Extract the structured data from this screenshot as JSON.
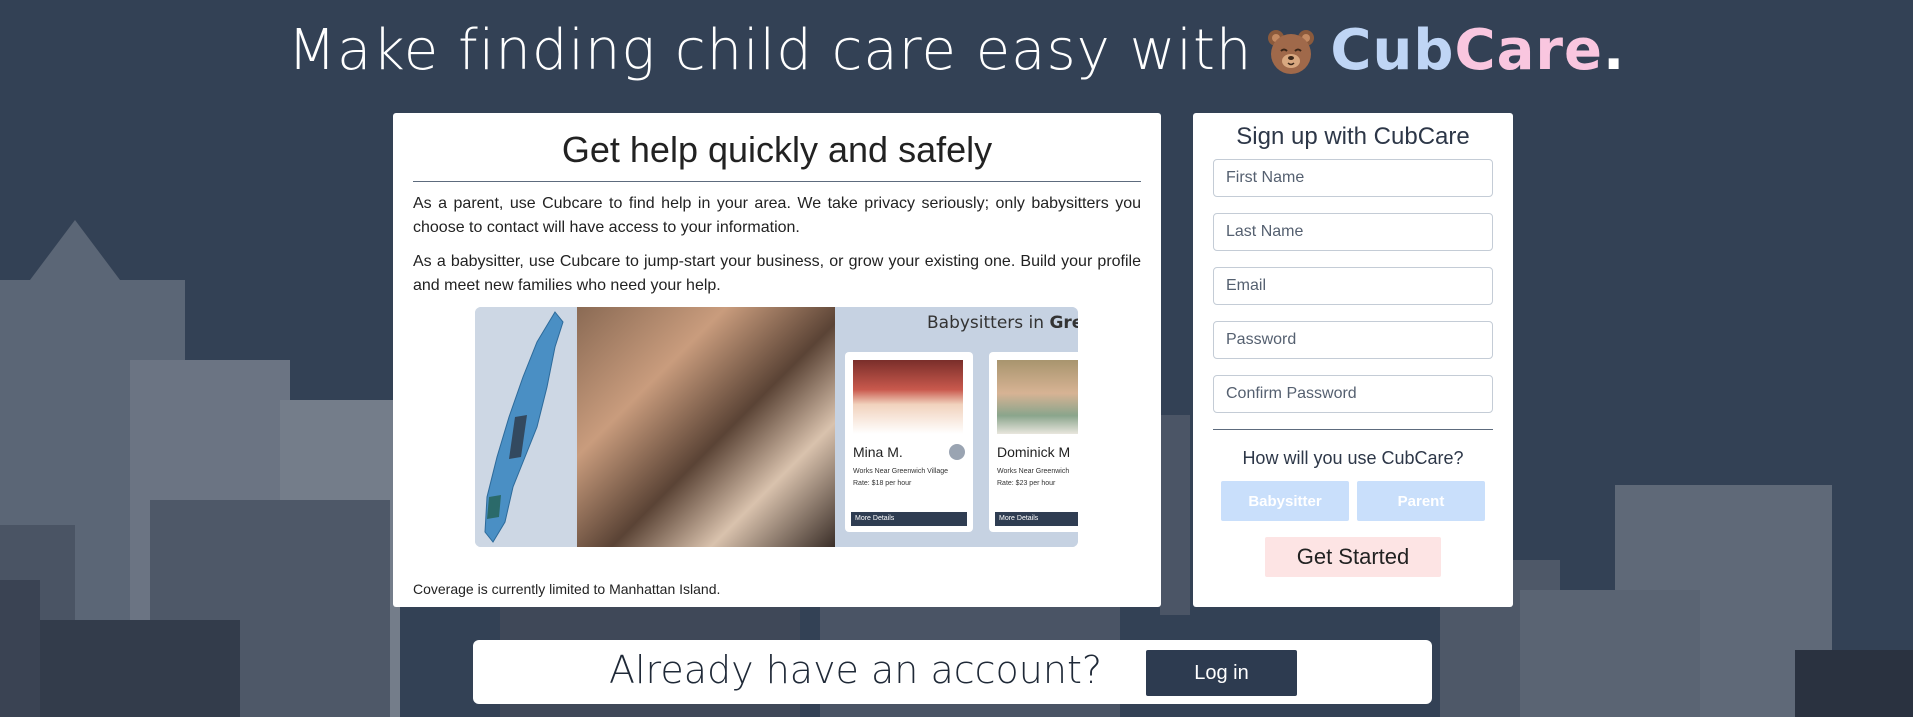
{
  "hero": {
    "headline": "Make finding child care easy with",
    "brand_part1": "Cub",
    "brand_part2": "Care",
    "brand_period": "."
  },
  "info": {
    "title": "Get help quickly and safely",
    "paragraph_parent": "As a parent, use Cubcare to find help in your area. We take privacy seriously; only babysitters you choose to contact will have access to your information.",
    "paragraph_sitter": "As a babysitter, use Cubcare to jump-start your business, or grow your existing one. Build your profile and meet new families who need your help.",
    "coverage": "Coverage is currently limited to Manhattan Island.",
    "promo": {
      "title_prefix": "Babysitters in ",
      "title_place": "Gree",
      "sitters": [
        {
          "name": "Mina M.",
          "location": "Works Near Greenwich Village",
          "rate": "Rate: $18 per hour",
          "more": "More Details"
        },
        {
          "name": "Dominick M",
          "location": "Works Near Greenwich",
          "rate": "Rate: $23 per hour",
          "more": "More Details"
        }
      ]
    }
  },
  "signup": {
    "title": "Sign up with CubCare",
    "fields": {
      "first_name": "First Name",
      "last_name": "Last Name",
      "email": "Email",
      "password": "Password",
      "confirm_password": "Confirm Password"
    },
    "question": "How will you use CubCare?",
    "role_babysitter": "Babysitter",
    "role_parent": "Parent",
    "submit": "Get Started"
  },
  "login": {
    "prompt": "Already have an account?",
    "button": "Log in"
  },
  "colors": {
    "background": "#334155",
    "brand_blue": "#bfd5f5",
    "brand_pink": "#f9c6df",
    "dark_button": "#2d3b50",
    "role_button": "#c9dffb",
    "submit_button": "#fde4e4"
  }
}
